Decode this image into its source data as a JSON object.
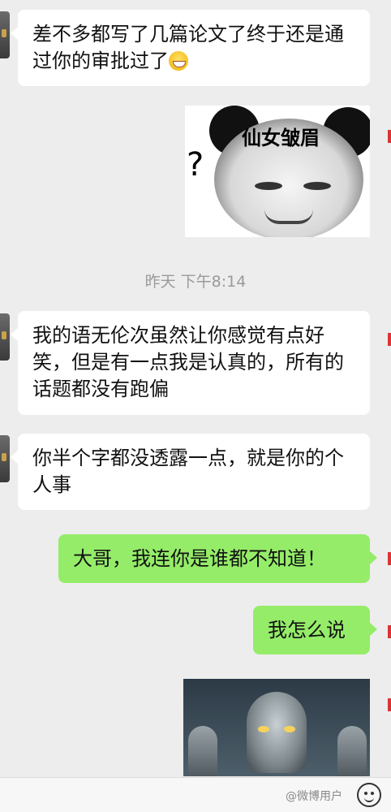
{
  "messages": {
    "m1": "差不多都写了几篇论文了终于还是通过你的审批过了",
    "m2": "我的语无伦次虽然让你感觉有点好笑，但是有一点我是认真的，所有的话题都没有跑偏",
    "m3": "你半个字都没透露一点，就是你的个人事",
    "m4": "大哥，我连你是谁都不知道！",
    "m5": "我怎么说"
  },
  "sticker": {
    "caption": "仙女皱眉",
    "question_mark": "?"
  },
  "timestamp": "昨天 下午8:14",
  "watermark": "@微博用户",
  "icons": {
    "emoji": "grinning-emoji-icon",
    "input_emoji": "smiley-face-icon"
  },
  "colors": {
    "background": "#ededed",
    "incoming_bubble": "#ffffff",
    "outgoing_bubble": "#95ec69",
    "timestamp_text": "#9a9a9a"
  }
}
